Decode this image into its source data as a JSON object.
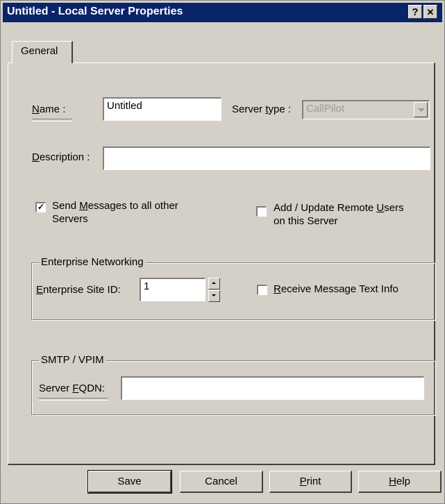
{
  "window": {
    "title": "Untitled - Local Server Properties",
    "help_label": "?",
    "close_label": "✕"
  },
  "tabs": [
    {
      "label": "General"
    }
  ],
  "name": {
    "label_prefix": "",
    "label_accel": "N",
    "label_rest": "ame :",
    "value": "Untitled"
  },
  "server_type": {
    "label_prefix": "Server ",
    "label_accel": "t",
    "label_rest": "ype :",
    "value": "CallPilot"
  },
  "description": {
    "label_accel": "D",
    "label_rest": "escription :",
    "value": ""
  },
  "send_messages": {
    "checked": true,
    "check_glyph": "✓",
    "line1_prefix": "Send ",
    "line1_accel": "M",
    "line1_rest": "essages to all other",
    "line2": "Servers"
  },
  "add_update": {
    "checked": false,
    "check_glyph": "",
    "line1_prefix": "Add / Update Remote ",
    "line1_accel": "U",
    "line1_rest": "sers",
    "line2": "on this Server"
  },
  "enterprise": {
    "group_label": "Enterprise Networking",
    "site_id_accel": "E",
    "site_id_rest": "nterprise Site ID:",
    "site_id_value": "1",
    "receive_accel": "R",
    "receive_rest": "eceive Message Text Info",
    "receive_checked": false
  },
  "smtp": {
    "group_label": "SMTP / VPIM",
    "fqdn_prefix": "Server ",
    "fqdn_accel": "F",
    "fqdn_rest": "QDN:",
    "fqdn_value": ""
  },
  "buttons": {
    "save": "Save",
    "cancel": "Cancel",
    "print_accel": "P",
    "print_rest": "rint",
    "help_accel": "H",
    "help_rest": "elp"
  }
}
